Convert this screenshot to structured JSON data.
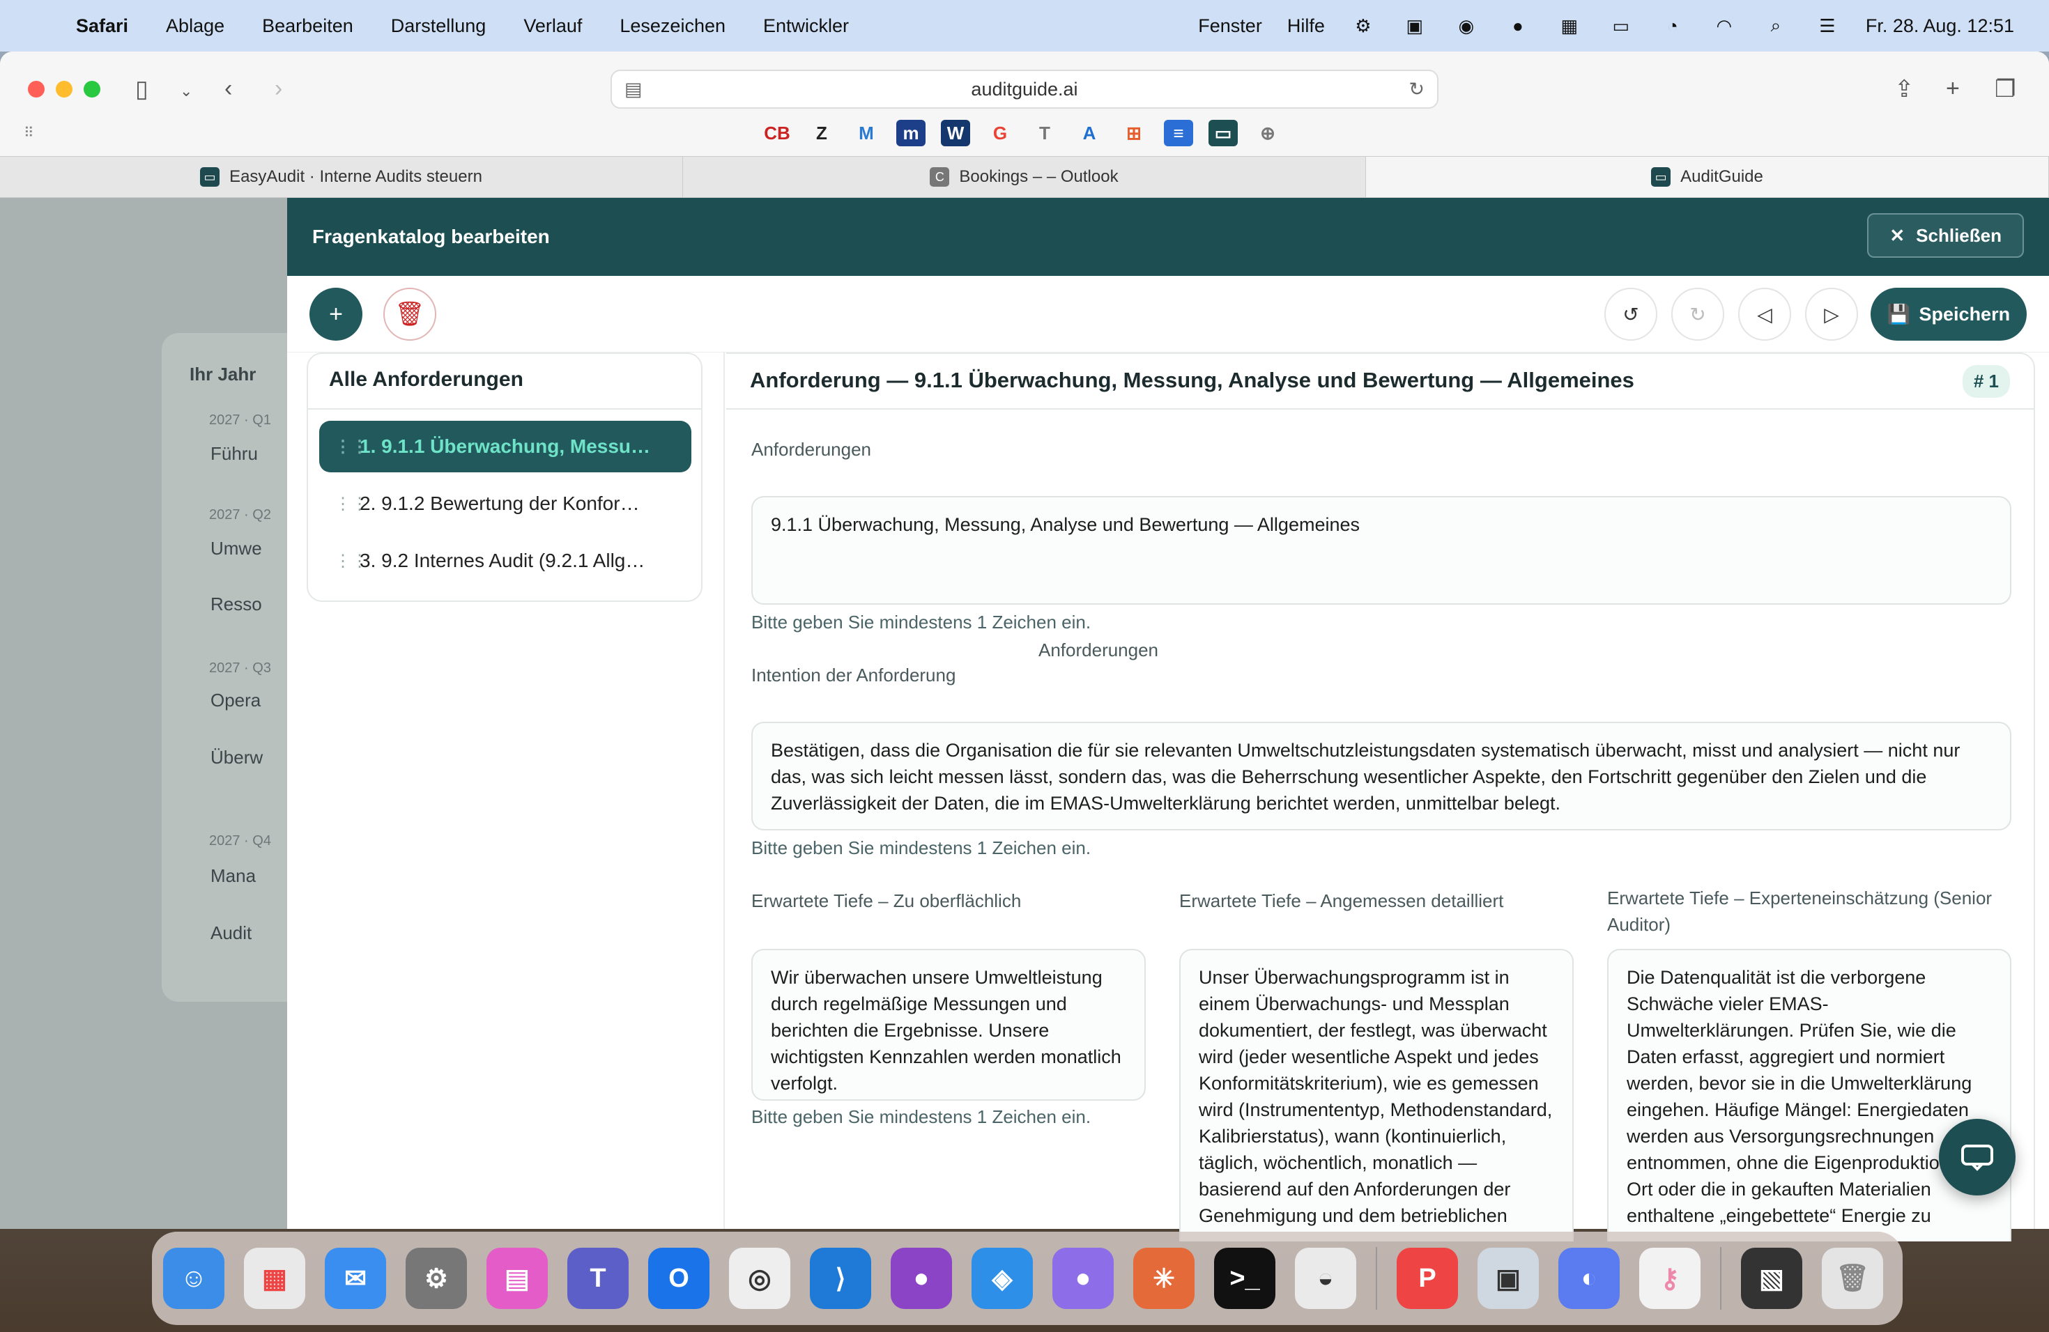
{
  "menubar": {
    "app": "Safari",
    "items": [
      "Ablage",
      "Bearbeiten",
      "Darstellung",
      "Verlauf",
      "Lesezeichen",
      "Entwickler"
    ],
    "right_items": [
      "Fenster",
      "Hilfe"
    ],
    "clock": "Fr. 28. Aug.  12:51"
  },
  "browser": {
    "url": "auditguide.ai",
    "tabs": [
      {
        "label": "EasyAudit · Interne Audits steuern"
      },
      {
        "label": "Bookings – – Outlook"
      },
      {
        "label": "AuditGuide"
      }
    ],
    "favorites": [
      "CB",
      "Z",
      "M",
      "m",
      "W",
      "G",
      "T",
      "A",
      "⊞",
      "≡",
      "▭",
      "⊕"
    ]
  },
  "background_page": {
    "title": "Ihr Jahr",
    "labels": [
      "2027 · Q1",
      "Führu",
      "2027 · Q2",
      "Umwe",
      "Resso",
      "2027 · Q3",
      "Opera",
      "Überw",
      "2027 · Q4",
      "Mana",
      "Audit"
    ]
  },
  "modal": {
    "title": "Fragenkatalog bearbeiten",
    "close_label": "Schließen",
    "save_label": "Speichern",
    "list_title": "Alle Anforderungen",
    "list_items": [
      "1. 9.1.1 Überwachung, Messu…",
      "2. 9.1.2 Bewertung der Konfor…",
      "3. 9.2 Internes Audit (9.2.1 Allg…"
    ],
    "detail_title": "Anforderung — 9.1.1 Überwachung, Messung, Analyse und Bewertung — Allgemeines",
    "detail_badge": "# 1",
    "fields": {
      "anforderungen_label": "Anforderungen",
      "anforderungen_value": "9.1.1 Überwachung, Messung, Analyse und Bewertung — Allgemeines",
      "hint": "Bitte geben Sie mindestens 1 Zeichen ein.",
      "intention_label": "Intention der Anforderung",
      "intention_value": "Bestätigen, dass die Organisation die für sie relevanten Umweltschutzleistungsdaten systematisch überwacht, misst und analysiert — nicht nur das, was sich leicht messen lässt, sondern das, was die Beherrschung wesentlicher Aspekte, den Fortschritt gegenüber den Zielen und die Zuverlässigkeit der Daten, die im EMAS-Umwelterklärung berichtet werden, unmittelbar belegt.",
      "tiefe1_label": "Erwartete Tiefe – Zu oberflächlich",
      "tiefe1_value": "Wir überwachen unsere Umweltleistung durch regelmäßige Messungen und berichten die Ergebnisse. Unsere wichtigsten Kennzahlen werden monatlich verfolgt.",
      "tiefe2_label": "Erwartete Tiefe – Angemessen detailliert",
      "tiefe2_value": "Unser Überwachungsprogramm ist in einem Überwachungs- und Messplan dokumentiert, der festlegt, was überwacht wird (jeder wesentliche Aspekt und jedes Konformitätskriterium), wie es gemessen wird (Instrumententyp, Methodenstandard, Kalibrierstatus), wann (kontinuierlich, täglich, wöchentlich, monatlich — basierend auf den Anforderungen der Genehmigung und dem betrieblichen",
      "tiefe3_label": "Erwartete Tiefe – Experteneinschätzung (Senior Auditor)",
      "tiefe3_value": "Die Datenqualität ist die verborgene Schwäche vieler EMAS-Umwelterklärungen. Prüfen Sie, wie die Daten erfasst, aggregiert und normiert werden, bevor sie in die Umwelterklärung eingehen. Häufige Mängel: Energiedaten werden aus Versorgungsrechnungen entnommen, ohne die Eigenproduktion vor Ort oder die in gekauften Materialien enthaltene „eingebettete“ Energie zu"
    }
  },
  "colors": {
    "brand": "#1c4e52",
    "accent": "#6fe3c8",
    "danger": "#cc2222"
  }
}
